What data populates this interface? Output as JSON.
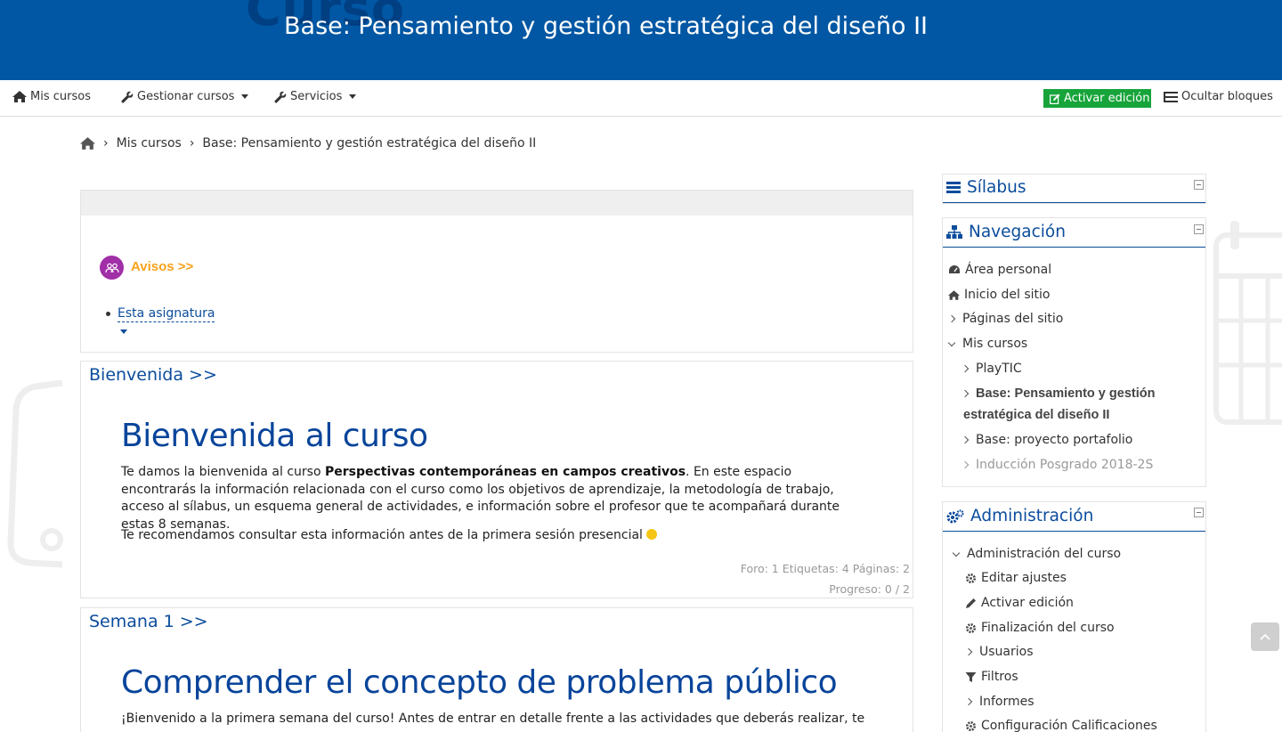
{
  "header": {
    "watermark_text": "Curso",
    "title": "Base: Pensamiento y gestión estratégica del diseño II"
  },
  "navbar": {
    "my_courses": "Mis cursos",
    "manage_courses": "Gestionar cursos",
    "services": "Servicios",
    "activate_edit": "Activar edición",
    "hide_blocks": "Ocultar bloques"
  },
  "breadcrumb": {
    "items": [
      "Mis cursos",
      "Base: Pensamiento y gestión estratégica del diseño II"
    ]
  },
  "main": {
    "forum": {
      "link": "Avisos >>",
      "subitem": "Esta asignatura"
    },
    "sections": [
      {
        "title": "Bienvenida >>",
        "heading": "Bienvenida al curso",
        "para1_pre": "Te damos la bienvenida al curso ",
        "para1_bold": "Perspectivas contemporáneas en campos creativos",
        "para1_post": ". En este espacio encontrarás la información relacionada con el curso como los objetivos de aprendizaje, la metodología de trabajo, acceso al sílabus, un esquema general de actividades, e información sobre el profesor que te acompañará durante estas 8 semanas.",
        "para2": "Te recomendamos consultar esta información antes de la primera sesión presencial",
        "meta": "Foro: 1  Etiquetas: 4  Páginas: 2",
        "progress": "Progreso: 0 / 2"
      },
      {
        "title": "Semana 1 >>",
        "heading": "Comprender el concepto de problema público",
        "para1": "¡Bienvenido a la primera semana del curso! Antes de entrar en detalle frente a las actividades que deberás realizar, te"
      }
    ]
  },
  "blocks": {
    "silabus": {
      "title": "Sílabus"
    },
    "navigation": {
      "title": "Navegación",
      "items": [
        "Área personal",
        "Inicio del sitio",
        "Páginas del sitio",
        "Mis cursos",
        "PlayTIC",
        "Base: Pensamiento y gestión",
        "estratégica del diseño II",
        "Base: proyecto portafolio",
        "Inducción Posgrado 2018-2S"
      ]
    },
    "admin": {
      "title": "Administración",
      "items": [
        "Administración del curso",
        "Editar ajustes",
        "Activar edición",
        "Finalización del curso",
        "Usuarios",
        "Filtros",
        "Informes",
        "Configuración Calificaciones"
      ]
    }
  },
  "colors": {
    "header_bg": "#0157a3",
    "accent_blue": "#0b4c9c",
    "edit_green": "#17a43a",
    "forum_orange": "#f7a21b",
    "forum_purple": "#a12fa8"
  }
}
